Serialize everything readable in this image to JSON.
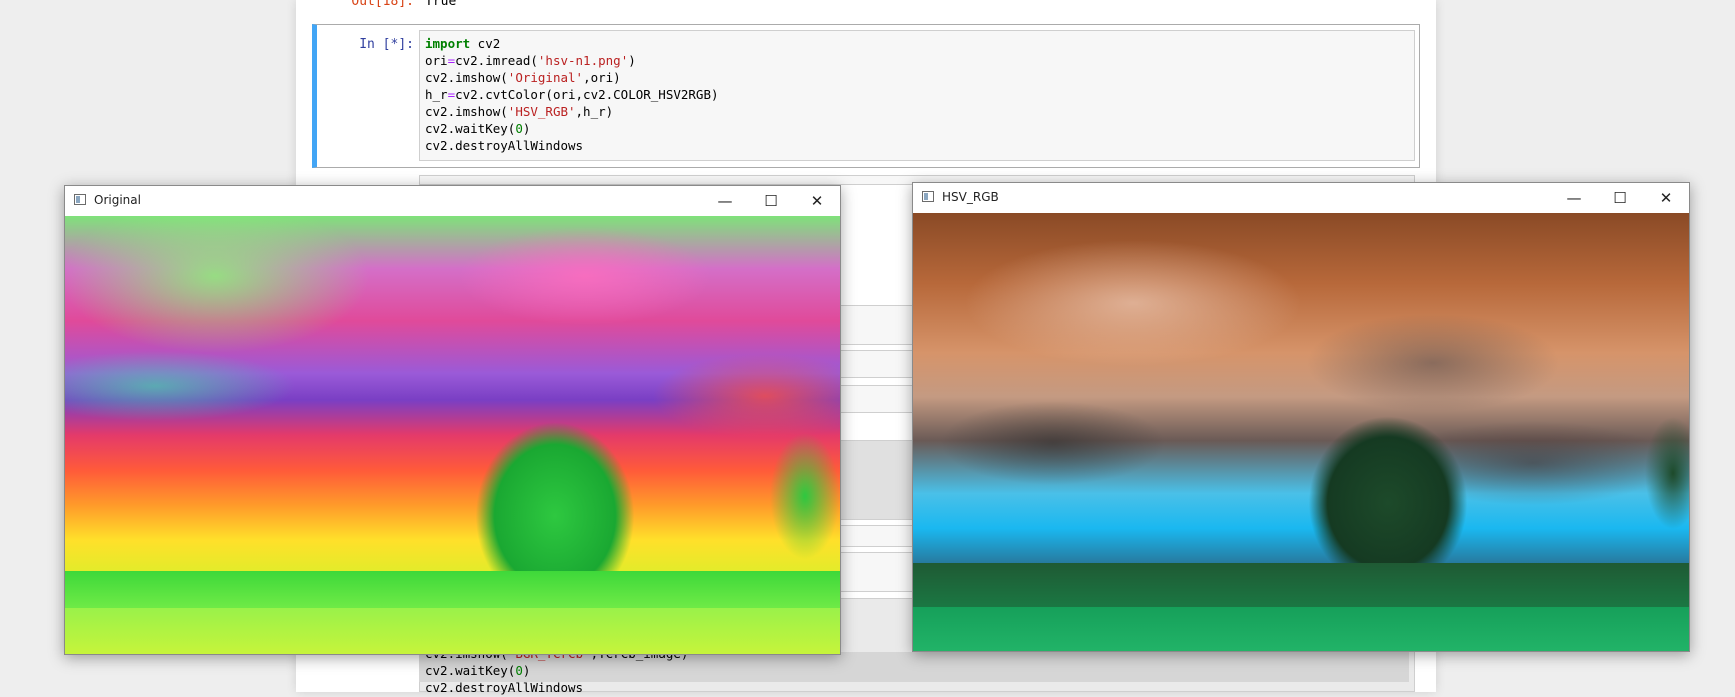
{
  "notebook": {
    "out_prompt": "Out[18]:",
    "out_value": "True",
    "in_prompt": "In [*]:",
    "code_lines": [
      [
        {
          "t": "import",
          "c": "kw"
        },
        {
          "t": " cv2",
          "c": ""
        }
      ],
      [
        {
          "t": "ori",
          "c": ""
        },
        {
          "t": "=",
          "c": "op"
        },
        {
          "t": "cv2.imread(",
          "c": ""
        },
        {
          "t": "'hsv-n1.png'",
          "c": "str"
        },
        {
          "t": ")",
          "c": ""
        }
      ],
      [
        {
          "t": "cv2.imshow(",
          "c": ""
        },
        {
          "t": "'Original'",
          "c": "str"
        },
        {
          "t": ",ori)",
          "c": ""
        }
      ],
      [
        {
          "t": "h_r",
          "c": ""
        },
        {
          "t": "=",
          "c": "op"
        },
        {
          "t": "cv2.cvtColor(ori,cv2.COLOR_HSV2RGB)",
          "c": ""
        }
      ],
      [
        {
          "t": "cv2.imshow(",
          "c": ""
        },
        {
          "t": "'HSV_RGB'",
          "c": "str"
        },
        {
          "t": ",h_r)",
          "c": ""
        }
      ],
      [
        {
          "t": "cv2.waitKey(",
          "c": ""
        },
        {
          "t": "0",
          "c": "num"
        },
        {
          "t": ")",
          "c": ""
        }
      ],
      [
        {
          "t": "cv2.destroyAllWindows",
          "c": ""
        }
      ]
    ],
    "partial_lines": [
      [
        {
          "t": ")",
          "c": ""
        }
      ],
      [
        {
          "t": "cv2.imshow(",
          "c": ""
        },
        {
          "t": "'BGR_YCrCb'",
          "c": "str"
        },
        {
          "t": ",YCrCb_image)",
          "c": ""
        }
      ],
      [
        {
          "t": "cv2.waitKey(",
          "c": ""
        },
        {
          "t": "0",
          "c": "num"
        },
        {
          "t": ")",
          "c": ""
        }
      ],
      [
        {
          "t": "cv2.destroyAllWindows",
          "c": ""
        }
      ]
    ]
  },
  "windows": {
    "original": {
      "title": "Original",
      "min": "—",
      "max": "☐",
      "close": "✕"
    },
    "hsv_rgb": {
      "title": "HSV_RGB",
      "min": "—",
      "max": "☐",
      "close": "✕"
    }
  }
}
